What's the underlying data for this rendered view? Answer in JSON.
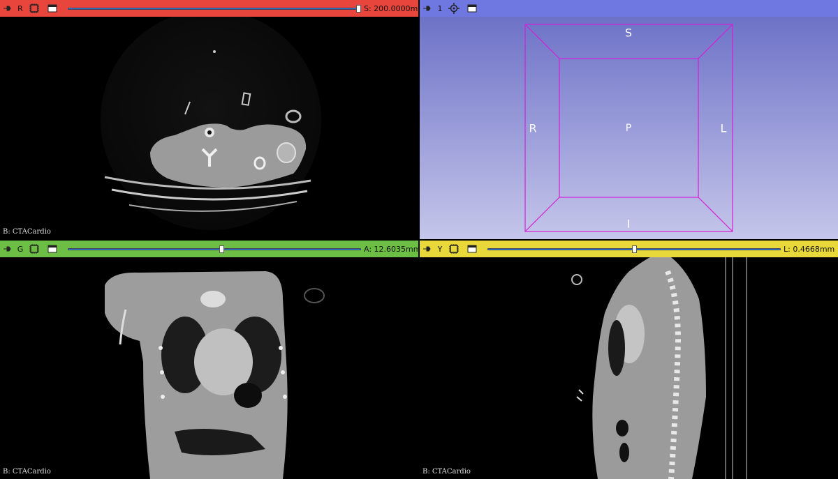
{
  "views": {
    "red": {
      "color": "#e8453c",
      "view_label": "R",
      "offset_label": "S: 200.0000mm",
      "offset_fraction": 1.0,
      "background_layer": "B: CTACardio"
    },
    "three_d": {
      "color": "#6f78e0",
      "view_label": "1",
      "bg_top": "#6d72c7",
      "bg_bottom": "#c5c6ea",
      "box_color": "#d51ed5",
      "orientation": {
        "superior": "S",
        "posterior": "P",
        "inferior": "I",
        "right": "R",
        "left": "L"
      }
    },
    "green": {
      "color": "#6dbe45",
      "view_label": "G",
      "offset_label": "A: 12.6035mm",
      "offset_fraction": 0.52,
      "background_layer": "B: CTACardio"
    },
    "yellow": {
      "color": "#e8d83a",
      "view_label": "Y",
      "offset_label": "L: 0.4668mm",
      "offset_fraction": 0.5,
      "background_layer": "B: CTACardio"
    }
  },
  "icons": {
    "pin": "pin-icon",
    "layers": "layers-icon",
    "maximize": "maximize-window-icon",
    "center": "center-view-icon"
  }
}
